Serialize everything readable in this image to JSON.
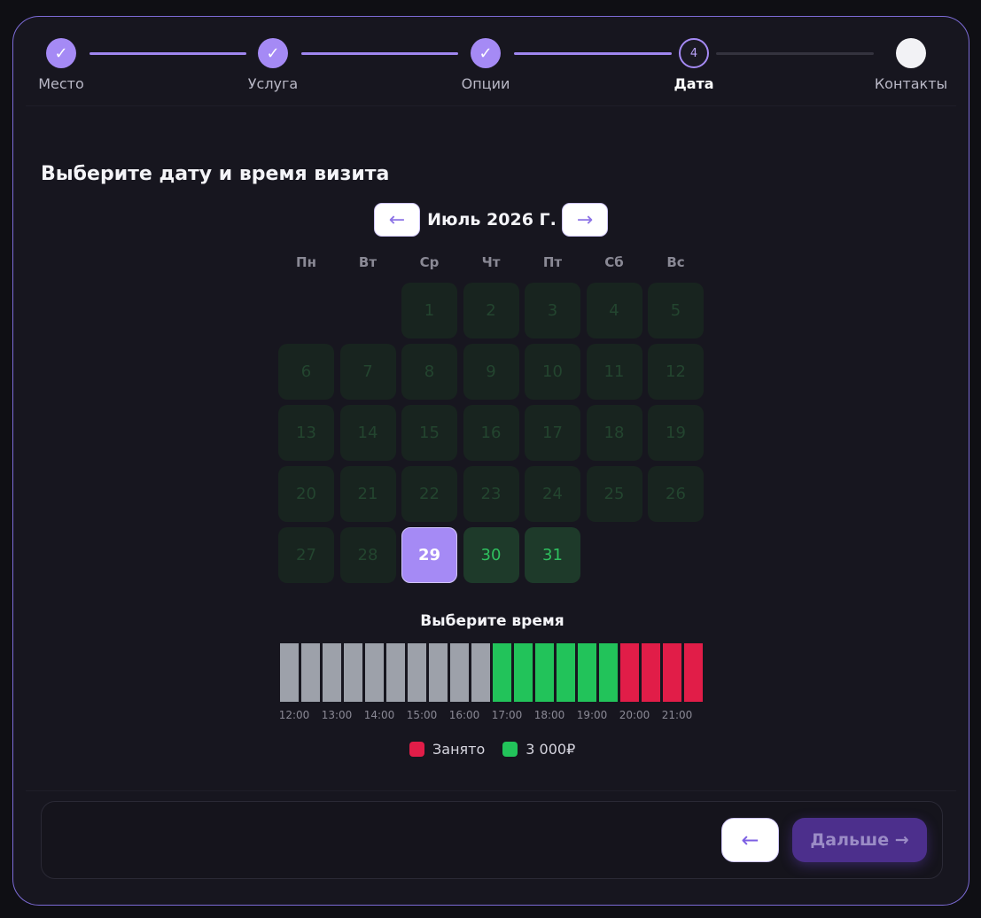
{
  "stepper": {
    "steps": [
      {
        "label": "Место",
        "state": "done",
        "mark": "✓"
      },
      {
        "label": "Услуга",
        "state": "done",
        "mark": "✓"
      },
      {
        "label": "Опции",
        "state": "done",
        "mark": "✓"
      },
      {
        "label": "Дата",
        "state": "active",
        "mark": "4"
      },
      {
        "label": "Контакты",
        "state": "todo",
        "mark": ""
      }
    ]
  },
  "main": {
    "title": "Выберите дату и время визита"
  },
  "calendar": {
    "prev_label": "←",
    "next_label": "→",
    "month": "Июль 2026 Г.",
    "weekdays": [
      "Пн",
      "Вт",
      "Ср",
      "Чт",
      "Пт",
      "Сб",
      "Вс"
    ],
    "leading_blanks": 2,
    "days": 31,
    "selected_day": 29,
    "available_days": [
      30,
      31
    ]
  },
  "time": {
    "title": "Выберите время",
    "slots": [
      "past",
      "past",
      "past",
      "past",
      "past",
      "past",
      "past",
      "past",
      "past",
      "past",
      "free",
      "free",
      "free",
      "free",
      "free",
      "free",
      "busy",
      "busy",
      "busy",
      "busy"
    ],
    "hour_labels": [
      "12:00",
      "13:00",
      "14:00",
      "15:00",
      "16:00",
      "17:00",
      "18:00",
      "19:00",
      "20:00",
      "21:00"
    ]
  },
  "legend": {
    "busy_label": "Занято",
    "free_label": "3 000₽"
  },
  "colors": {
    "accent": "#a58af5",
    "past": "#9da1aa",
    "free": "#22c35a",
    "busy": "#e11d48"
  },
  "footer": {
    "back_label": "←",
    "next_label": "Дальше →"
  }
}
